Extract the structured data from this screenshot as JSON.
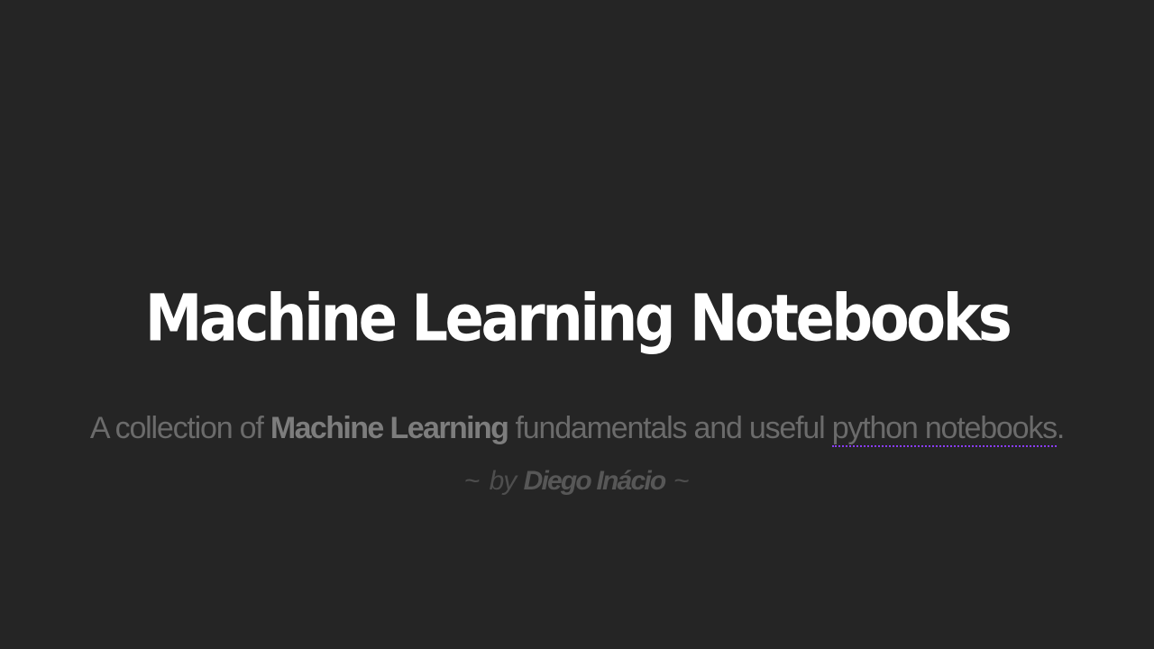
{
  "hero": {
    "title": "Machine Learning Notebooks",
    "subtitle": {
      "prefix": "A collection of ",
      "emphasis": "Machine Learning",
      "middle": " fundamentals and useful ",
      "link_text": "python notebooks",
      "suffix": "."
    },
    "byline": {
      "tilde_left": "~",
      "by": "by",
      "author": "Diego Inácio",
      "tilde_right": "~"
    }
  },
  "colors": {
    "background": "#252525",
    "title": "#ffffff",
    "subtitle": "#6b6b6b",
    "link_underline": "#8a3cff"
  }
}
